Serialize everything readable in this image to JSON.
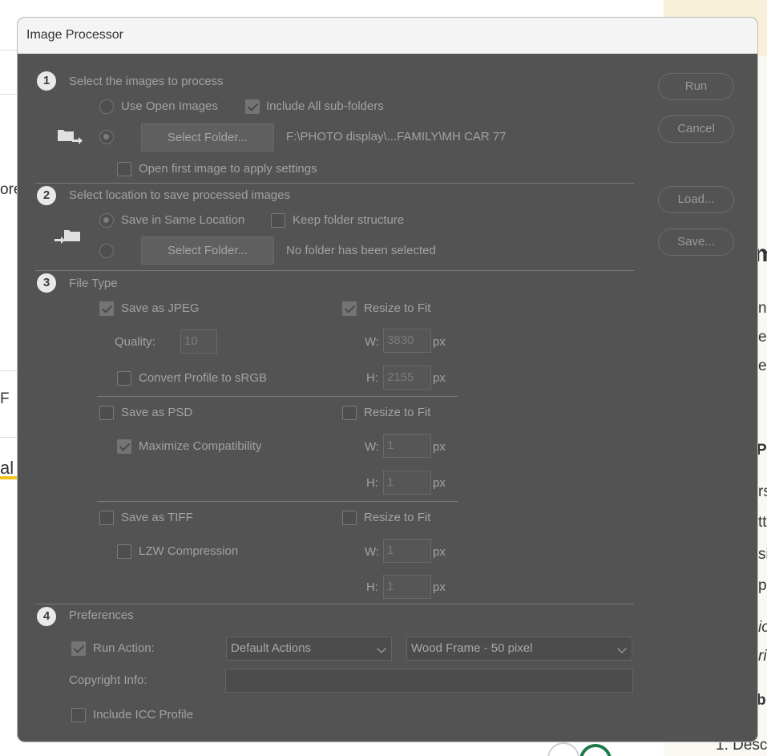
{
  "background": {
    "fragments": [
      "ore",
      "F",
      "al",
      "m",
      "ne",
      "e",
      "e",
      "P",
      "rs",
      "tt",
      "si",
      "pe",
      "io",
      "ri",
      "b",
      "1. Desc"
    ]
  },
  "dialog": {
    "title": "Image Processor",
    "steps": [
      "1",
      "2",
      "3",
      "4"
    ],
    "section1": {
      "heading": "Select the images to process",
      "use_open_images": "Use Open Images",
      "include_subfolders": "Include All sub-folders",
      "select_folder_label": "Select Folder...",
      "source_path": "F:\\PHOTO display\\...FAMILY\\MH CAR  77",
      "open_first_image": "Open first image to apply settings"
    },
    "section2": {
      "heading": "Select location to save processed images",
      "save_same_location": "Save in Same Location",
      "keep_folder_structure": "Keep folder structure",
      "select_folder_label": "Select Folder...",
      "dest_path": "No folder has been selected"
    },
    "section3": {
      "heading": "File Type",
      "jpeg": {
        "save_label": "Save as JPEG",
        "resize_label": "Resize to Fit",
        "quality_label": "Quality:",
        "quality_value": "10",
        "w_label": "W:",
        "w_value": "3830",
        "h_label": "H:",
        "h_value": "2155",
        "unit": "px",
        "convert_profile": "Convert Profile to sRGB"
      },
      "psd": {
        "save_label": "Save as PSD",
        "resize_label": "Resize to Fit",
        "max_compat": "Maximize Compatibility",
        "w_label": "W:",
        "w_value": "1",
        "h_label": "H:",
        "h_value": "1",
        "unit": "px"
      },
      "tiff": {
        "save_label": "Save as TIFF",
        "resize_label": "Resize to Fit",
        "lzw": "LZW Compression",
        "w_label": "W:",
        "w_value": "1",
        "h_label": "H:",
        "h_value": "1",
        "unit": "px"
      }
    },
    "section4": {
      "heading": "Preferences",
      "run_action": "Run Action:",
      "action_set": "Default Actions",
      "action": "Wood Frame - 50 pixel",
      "copyright_label": "Copyright Info:",
      "copyright_value": "",
      "include_icc": "Include ICC Profile"
    },
    "buttons": {
      "run": "Run",
      "cancel": "Cancel",
      "load": "Load...",
      "save": "Save..."
    }
  }
}
